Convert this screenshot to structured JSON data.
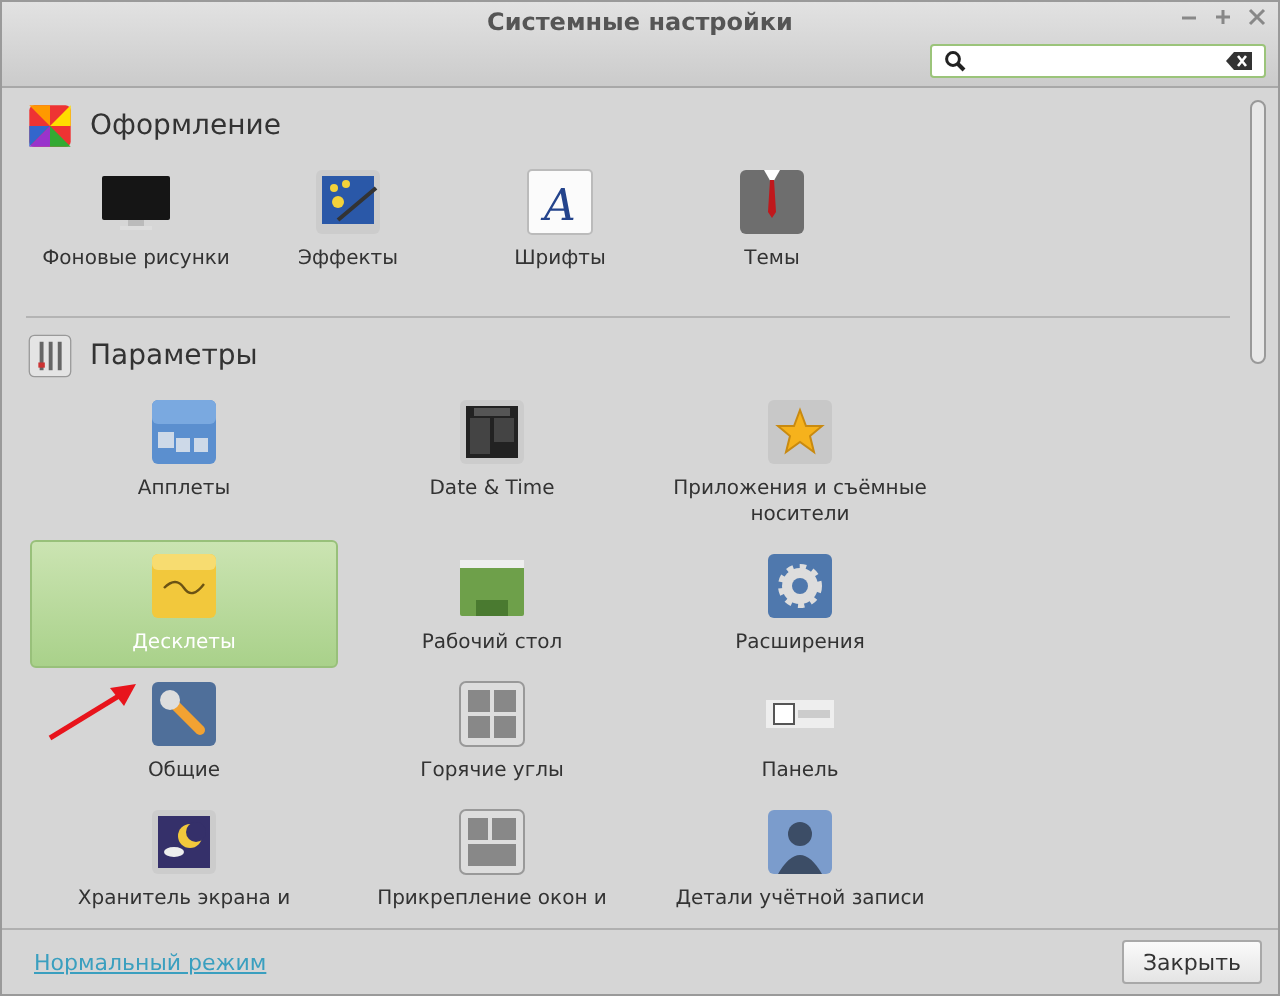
{
  "window": {
    "title": "Системные настройки"
  },
  "search": {
    "kind": "search"
  },
  "sections": [
    {
      "title": "Оформление",
      "items": [
        {
          "label": "Фоновые рисунки",
          "selected": false
        },
        {
          "label": "Эффекты",
          "selected": false
        },
        {
          "label": "Шрифты",
          "glyph": "A",
          "selected": false
        },
        {
          "label": "Темы",
          "selected": false
        }
      ]
    },
    {
      "title": "Параметры",
      "items": [
        {
          "label": "Апплеты",
          "selected": false
        },
        {
          "label": "Date & Time",
          "selected": false
        },
        {
          "label": "Приложения и съёмные носители",
          "selected": false
        },
        {
          "label": "Десклеты",
          "selected": true
        },
        {
          "label": "Рабочий стол",
          "selected": false
        },
        {
          "label": "Расширения",
          "selected": false
        },
        {
          "label": "Общие",
          "selected": false
        },
        {
          "label": "Горячие углы",
          "selected": false
        },
        {
          "label": "Панель",
          "selected": false
        },
        {
          "label": "Хранитель экрана и",
          "selected": false
        },
        {
          "label": "Прикрепление окон и",
          "selected": false
        },
        {
          "label": "Детали учётной записи",
          "selected": false
        }
      ]
    }
  ],
  "footer": {
    "link": "Нормальный режим",
    "button": "Закрыть"
  }
}
